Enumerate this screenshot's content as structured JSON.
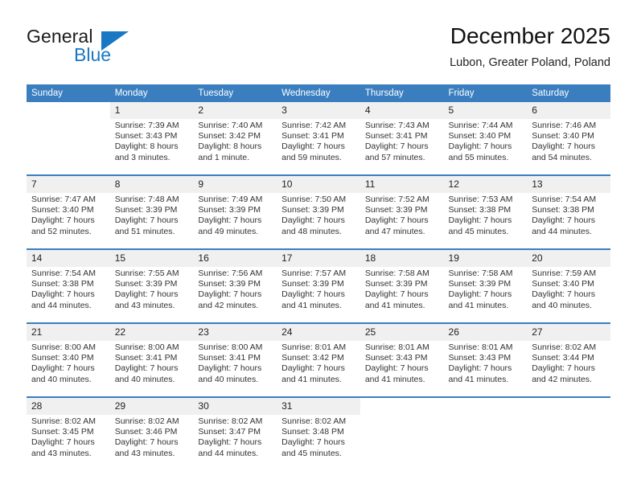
{
  "brand": {
    "name_part1": "General",
    "name_part2": "Blue",
    "flag_icon": "triangle-flag-icon",
    "accent_color": "#1878c4"
  },
  "header": {
    "title": "December 2025",
    "location": "Lubon, Greater Poland, Poland"
  },
  "calendar": {
    "header_bg_color": "#3a7ebf",
    "daynum_bg_color": "#f0f0f0",
    "weekday_headers": [
      "Sunday",
      "Monday",
      "Tuesday",
      "Wednesday",
      "Thursday",
      "Friday",
      "Saturday"
    ],
    "weeks": [
      [
        {
          "day": "",
          "empty": true,
          "sunrise": "",
          "sunset": "",
          "daylight1": "",
          "daylight2": ""
        },
        {
          "day": "1",
          "sunrise": "Sunrise: 7:39 AM",
          "sunset": "Sunset: 3:43 PM",
          "daylight1": "Daylight: 8 hours",
          "daylight2": "and 3 minutes."
        },
        {
          "day": "2",
          "sunrise": "Sunrise: 7:40 AM",
          "sunset": "Sunset: 3:42 PM",
          "daylight1": "Daylight: 8 hours",
          "daylight2": "and 1 minute."
        },
        {
          "day": "3",
          "sunrise": "Sunrise: 7:42 AM",
          "sunset": "Sunset: 3:41 PM",
          "daylight1": "Daylight: 7 hours",
          "daylight2": "and 59 minutes."
        },
        {
          "day": "4",
          "sunrise": "Sunrise: 7:43 AM",
          "sunset": "Sunset: 3:41 PM",
          "daylight1": "Daylight: 7 hours",
          "daylight2": "and 57 minutes."
        },
        {
          "day": "5",
          "sunrise": "Sunrise: 7:44 AM",
          "sunset": "Sunset: 3:40 PM",
          "daylight1": "Daylight: 7 hours",
          "daylight2": "and 55 minutes."
        },
        {
          "day": "6",
          "sunrise": "Sunrise: 7:46 AM",
          "sunset": "Sunset: 3:40 PM",
          "daylight1": "Daylight: 7 hours",
          "daylight2": "and 54 minutes."
        }
      ],
      [
        {
          "day": "7",
          "sunrise": "Sunrise: 7:47 AM",
          "sunset": "Sunset: 3:40 PM",
          "daylight1": "Daylight: 7 hours",
          "daylight2": "and 52 minutes."
        },
        {
          "day": "8",
          "sunrise": "Sunrise: 7:48 AM",
          "sunset": "Sunset: 3:39 PM",
          "daylight1": "Daylight: 7 hours",
          "daylight2": "and 51 minutes."
        },
        {
          "day": "9",
          "sunrise": "Sunrise: 7:49 AM",
          "sunset": "Sunset: 3:39 PM",
          "daylight1": "Daylight: 7 hours",
          "daylight2": "and 49 minutes."
        },
        {
          "day": "10",
          "sunrise": "Sunrise: 7:50 AM",
          "sunset": "Sunset: 3:39 PM",
          "daylight1": "Daylight: 7 hours",
          "daylight2": "and 48 minutes."
        },
        {
          "day": "11",
          "sunrise": "Sunrise: 7:52 AM",
          "sunset": "Sunset: 3:39 PM",
          "daylight1": "Daylight: 7 hours",
          "daylight2": "and 47 minutes."
        },
        {
          "day": "12",
          "sunrise": "Sunrise: 7:53 AM",
          "sunset": "Sunset: 3:38 PM",
          "daylight1": "Daylight: 7 hours",
          "daylight2": "and 45 minutes."
        },
        {
          "day": "13",
          "sunrise": "Sunrise: 7:54 AM",
          "sunset": "Sunset: 3:38 PM",
          "daylight1": "Daylight: 7 hours",
          "daylight2": "and 44 minutes."
        }
      ],
      [
        {
          "day": "14",
          "sunrise": "Sunrise: 7:54 AM",
          "sunset": "Sunset: 3:38 PM",
          "daylight1": "Daylight: 7 hours",
          "daylight2": "and 44 minutes."
        },
        {
          "day": "15",
          "sunrise": "Sunrise: 7:55 AM",
          "sunset": "Sunset: 3:39 PM",
          "daylight1": "Daylight: 7 hours",
          "daylight2": "and 43 minutes."
        },
        {
          "day": "16",
          "sunrise": "Sunrise: 7:56 AM",
          "sunset": "Sunset: 3:39 PM",
          "daylight1": "Daylight: 7 hours",
          "daylight2": "and 42 minutes."
        },
        {
          "day": "17",
          "sunrise": "Sunrise: 7:57 AM",
          "sunset": "Sunset: 3:39 PM",
          "daylight1": "Daylight: 7 hours",
          "daylight2": "and 41 minutes."
        },
        {
          "day": "18",
          "sunrise": "Sunrise: 7:58 AM",
          "sunset": "Sunset: 3:39 PM",
          "daylight1": "Daylight: 7 hours",
          "daylight2": "and 41 minutes."
        },
        {
          "day": "19",
          "sunrise": "Sunrise: 7:58 AM",
          "sunset": "Sunset: 3:39 PM",
          "daylight1": "Daylight: 7 hours",
          "daylight2": "and 41 minutes."
        },
        {
          "day": "20",
          "sunrise": "Sunrise: 7:59 AM",
          "sunset": "Sunset: 3:40 PM",
          "daylight1": "Daylight: 7 hours",
          "daylight2": "and 40 minutes."
        }
      ],
      [
        {
          "day": "21",
          "sunrise": "Sunrise: 8:00 AM",
          "sunset": "Sunset: 3:40 PM",
          "daylight1": "Daylight: 7 hours",
          "daylight2": "and 40 minutes."
        },
        {
          "day": "22",
          "sunrise": "Sunrise: 8:00 AM",
          "sunset": "Sunset: 3:41 PM",
          "daylight1": "Daylight: 7 hours",
          "daylight2": "and 40 minutes."
        },
        {
          "day": "23",
          "sunrise": "Sunrise: 8:00 AM",
          "sunset": "Sunset: 3:41 PM",
          "daylight1": "Daylight: 7 hours",
          "daylight2": "and 40 minutes."
        },
        {
          "day": "24",
          "sunrise": "Sunrise: 8:01 AM",
          "sunset": "Sunset: 3:42 PM",
          "daylight1": "Daylight: 7 hours",
          "daylight2": "and 41 minutes."
        },
        {
          "day": "25",
          "sunrise": "Sunrise: 8:01 AM",
          "sunset": "Sunset: 3:43 PM",
          "daylight1": "Daylight: 7 hours",
          "daylight2": "and 41 minutes."
        },
        {
          "day": "26",
          "sunrise": "Sunrise: 8:01 AM",
          "sunset": "Sunset: 3:43 PM",
          "daylight1": "Daylight: 7 hours",
          "daylight2": "and 41 minutes."
        },
        {
          "day": "27",
          "sunrise": "Sunrise: 8:02 AM",
          "sunset": "Sunset: 3:44 PM",
          "daylight1": "Daylight: 7 hours",
          "daylight2": "and 42 minutes."
        }
      ],
      [
        {
          "day": "28",
          "sunrise": "Sunrise: 8:02 AM",
          "sunset": "Sunset: 3:45 PM",
          "daylight1": "Daylight: 7 hours",
          "daylight2": "and 43 minutes."
        },
        {
          "day": "29",
          "sunrise": "Sunrise: 8:02 AM",
          "sunset": "Sunset: 3:46 PM",
          "daylight1": "Daylight: 7 hours",
          "daylight2": "and 43 minutes."
        },
        {
          "day": "30",
          "sunrise": "Sunrise: 8:02 AM",
          "sunset": "Sunset: 3:47 PM",
          "daylight1": "Daylight: 7 hours",
          "daylight2": "and 44 minutes."
        },
        {
          "day": "31",
          "sunrise": "Sunrise: 8:02 AM",
          "sunset": "Sunset: 3:48 PM",
          "daylight1": "Daylight: 7 hours",
          "daylight2": "and 45 minutes."
        },
        {
          "day": "",
          "empty": true,
          "sunrise": "",
          "sunset": "",
          "daylight1": "",
          "daylight2": ""
        },
        {
          "day": "",
          "empty": true,
          "sunrise": "",
          "sunset": "",
          "daylight1": "",
          "daylight2": ""
        },
        {
          "day": "",
          "empty": true,
          "sunrise": "",
          "sunset": "",
          "daylight1": "",
          "daylight2": ""
        }
      ]
    ]
  }
}
